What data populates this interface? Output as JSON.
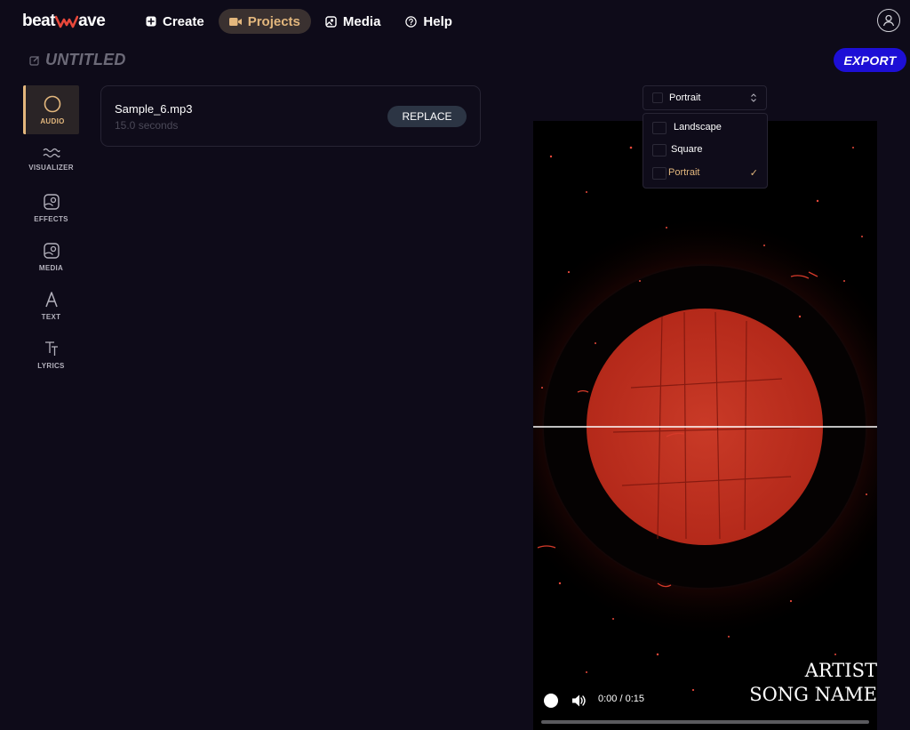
{
  "app": {
    "logo_text_1": "beat",
    "logo_text_2": "ave",
    "accent_color": "#e3b77d",
    "export_color": "#1d0fd6"
  },
  "nav": {
    "items": [
      {
        "label": "Create",
        "icon": "plus-square-icon",
        "active": false
      },
      {
        "label": "Projects",
        "icon": "video-camera-icon",
        "active": true
      },
      {
        "label": "Media",
        "icon": "image-icon",
        "active": false
      },
      {
        "label": "Help",
        "icon": "question-circle-icon",
        "active": false
      }
    ]
  },
  "project": {
    "title": "UNTITLED",
    "export_label": "EXPORT"
  },
  "tools": [
    {
      "label": "AUDIO",
      "icon": "circle-icon",
      "active": true
    },
    {
      "label": "VISUALIZER",
      "icon": "waveform-icon",
      "active": false
    },
    {
      "label": "EFFECTS",
      "icon": "effects-icon",
      "active": false
    },
    {
      "label": "MEDIA",
      "icon": "media-icon",
      "active": false
    },
    {
      "label": "TEXT",
      "icon": "text-a-icon",
      "active": false
    },
    {
      "label": "LYRICS",
      "icon": "lyrics-tt-icon",
      "active": false
    }
  ],
  "audio": {
    "filename": "Sample_6.mp3",
    "duration": "15.0 seconds",
    "replace_label": "REPLACE"
  },
  "aspect": {
    "selected": "Portrait",
    "options": [
      {
        "label": "Landscape",
        "selected": false
      },
      {
        "label": "Square",
        "selected": false
      },
      {
        "label": "Portrait",
        "selected": true
      }
    ],
    "check_mark": "✓"
  },
  "preview": {
    "artist": "ARTIST",
    "song": "SONG NAME",
    "time": "0:00 / 0:15",
    "progress": 0
  }
}
